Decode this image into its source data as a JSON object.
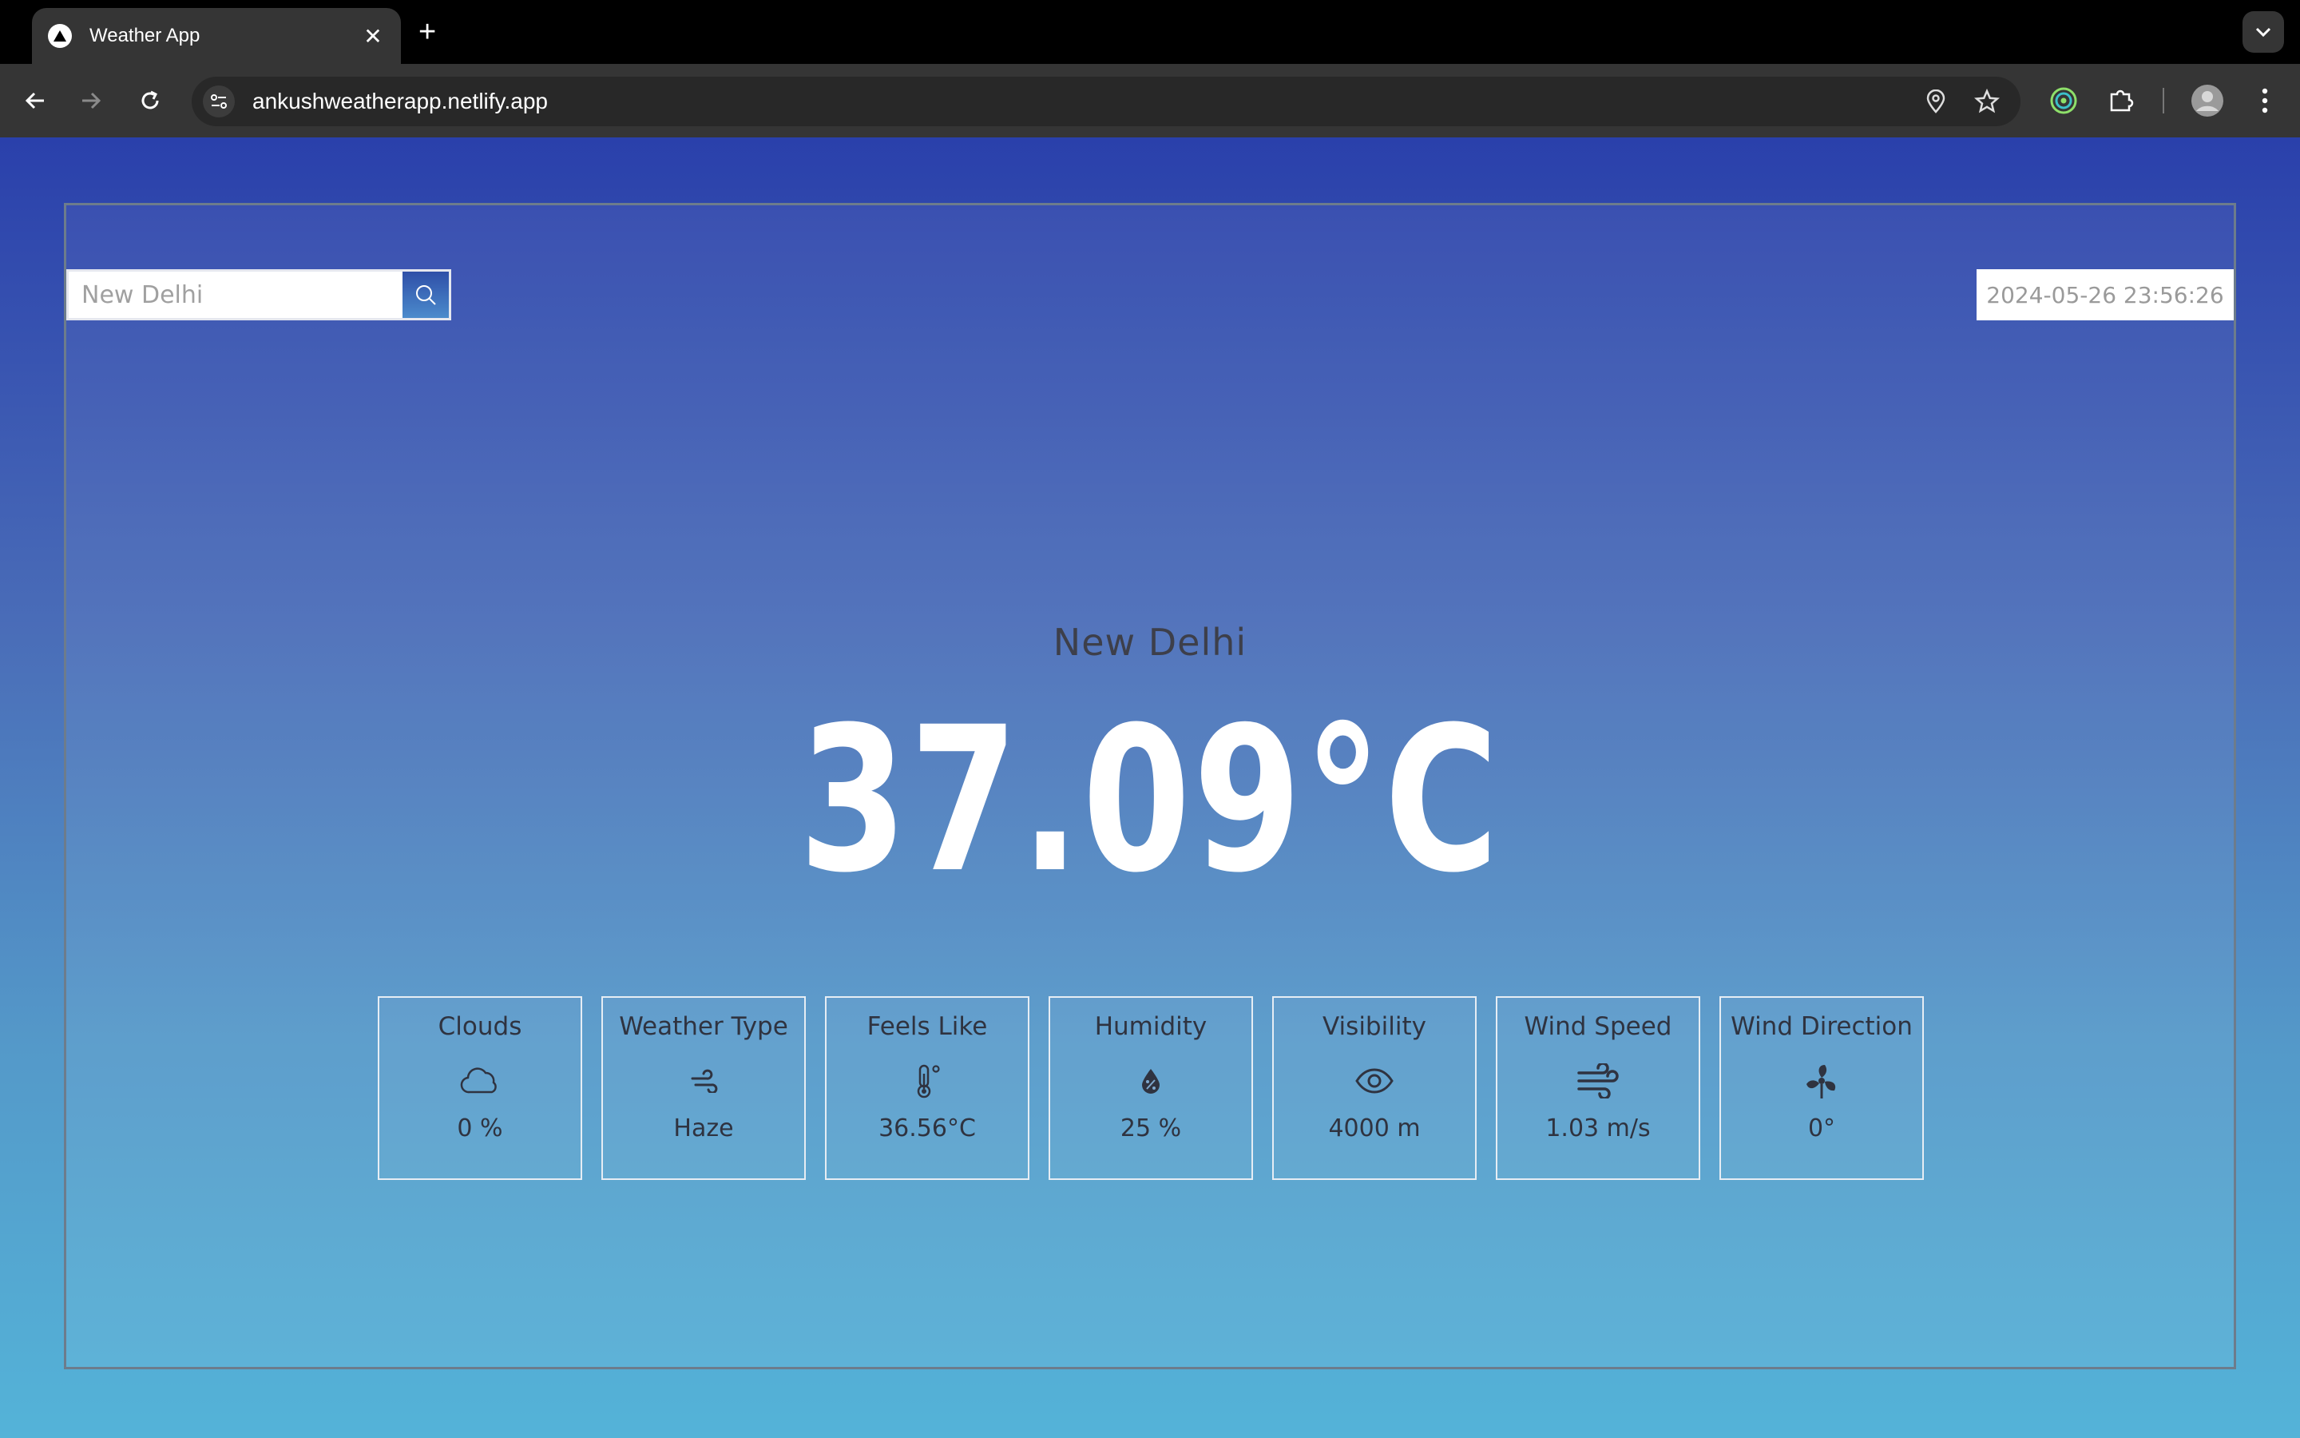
{
  "browser": {
    "tab_title": "Weather App",
    "url": "ankushweatherapp.netlify.app"
  },
  "search": {
    "placeholder": "New Delhi"
  },
  "datetime": "2024-05-26 23:56:26",
  "city": "New Delhi",
  "temperature": "37.09°C",
  "cards": [
    {
      "label": "Clouds",
      "value": "0 %",
      "icon": "cloud-icon"
    },
    {
      "label": "Weather Type",
      "value": "Haze",
      "icon": "haze-icon"
    },
    {
      "label": "Feels Like",
      "value": "36.56°C",
      "icon": "thermometer-icon"
    },
    {
      "label": "Humidity",
      "value": "25 %",
      "icon": "humidity-icon"
    },
    {
      "label": "Visibility",
      "value": "4000 m",
      "icon": "eye-icon"
    },
    {
      "label": "Wind Speed",
      "value": "1.03 m/s",
      "icon": "wind-icon"
    },
    {
      "label": "Wind Direction",
      "value": "0°",
      "icon": "fan-icon"
    }
  ]
}
